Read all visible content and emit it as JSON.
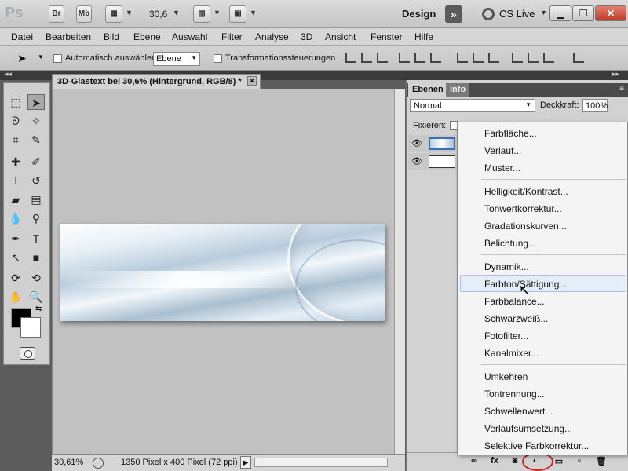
{
  "titlebar": {
    "app_logo": "Ps",
    "bridge": "Br",
    "minibridge": "Mb",
    "zoom": "30,6",
    "workspace": "Design",
    "cslive": "CS Live"
  },
  "menu": [
    "Datei",
    "Bearbeiten",
    "Bild",
    "Ebene",
    "Auswahl",
    "Filter",
    "Analyse",
    "3D",
    "Ansicht",
    "Fenster",
    "Hilfe"
  ],
  "options": {
    "auto_select_label": "Automatisch auswählen:",
    "auto_select_value": "Ebene",
    "transform_label": "Transformationssteuerungen"
  },
  "document": {
    "tab_title": "3D-Glastext bei 30,6% (Hintergrund, RGB/8) *",
    "zoom": "30,61%",
    "info": "1350 Pixel x 400 Pixel (72 ppi)"
  },
  "layers_panel": {
    "tabs": [
      "Ebenen",
      "Info"
    ],
    "blend_mode": "Normal",
    "opacity_label": "Deckkraft:",
    "opacity_value": "100%",
    "lock_label": "Fixieren:"
  },
  "adjustment_menu": {
    "group1": [
      "Farbfläche...",
      "Verlauf...",
      "Muster..."
    ],
    "group2": [
      "Helligkeit/Kontrast...",
      "Tonwertkorrektur...",
      "Gradationskurven...",
      "Belichtung..."
    ],
    "group3": [
      "Dynamik...",
      "Farbton/Sättigung...",
      "Farbbalance...",
      "Schwarzweiß...",
      "Fotofilter...",
      "Kanalmixer..."
    ],
    "group4": [
      "Umkehren",
      "Tontrennung...",
      "Schwellenwert...",
      "Verlaufsumsetzung...",
      "Selektive Farbkorrektur..."
    ],
    "hovered": "Farbton/Sättigung..."
  },
  "colors": {
    "highlight": "#e5eef8",
    "accent_red": "#d42020"
  }
}
